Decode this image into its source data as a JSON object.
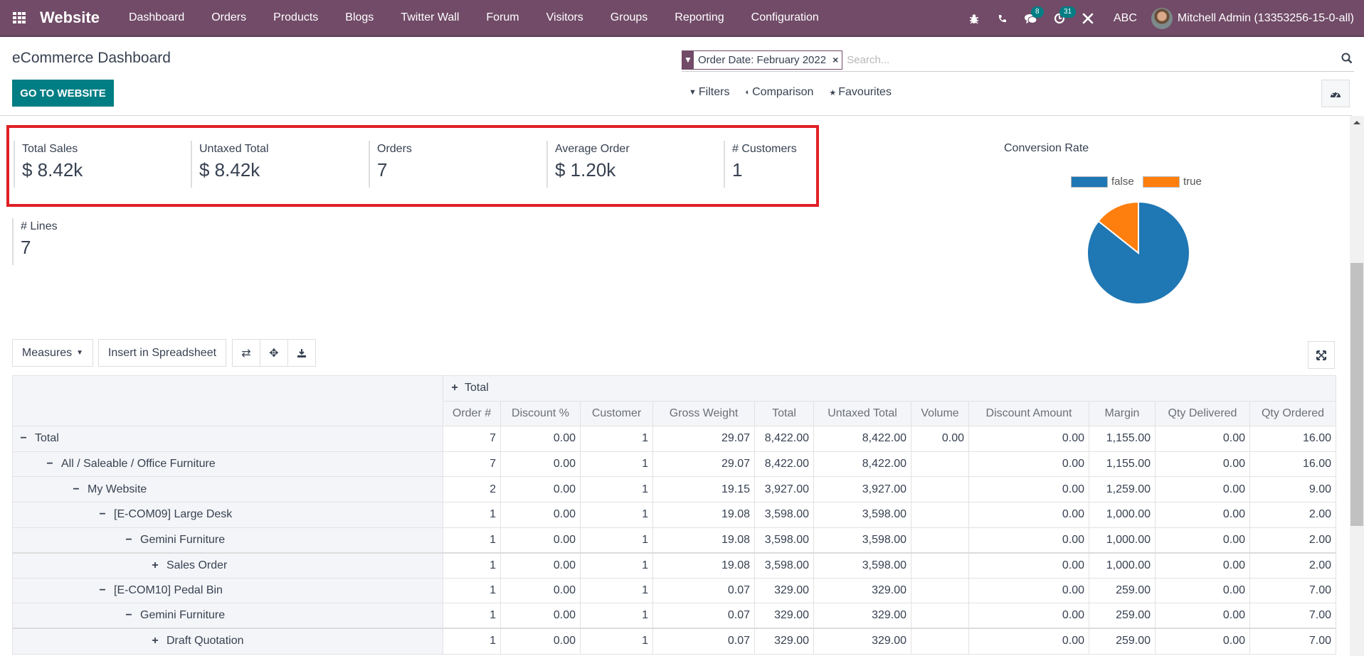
{
  "navbar": {
    "app_name": "Website",
    "menu": [
      "Dashboard",
      "Orders",
      "Products",
      "Blogs",
      "Twitter Wall",
      "Forum",
      "Visitors",
      "Groups",
      "Reporting",
      "Configuration"
    ],
    "icons": [
      "bug-icon",
      "phone-icon",
      "chat-icon",
      "activity-clock-icon",
      "tools-icon"
    ],
    "messages_badge": "8",
    "activities_badge": "31",
    "company": "ABC",
    "user": "Mitchell Admin (13353256-15-0-all)"
  },
  "control_panel": {
    "title": "eCommerce Dashboard",
    "go_to_website": "GO TO WEBSITE",
    "facet_value": "Order Date: February 2022",
    "search_placeholder": "Search...",
    "filters": "Filters",
    "comparison": "Comparison",
    "favourites": "Favourites"
  },
  "kpis": [
    {
      "label": "Total Sales",
      "value": "$ 8.42k"
    },
    {
      "label": "Untaxed Total",
      "value": "$ 8.42k"
    },
    {
      "label": "Orders",
      "value": "7"
    },
    {
      "label": "Average Order",
      "value": "$ 1.20k"
    },
    {
      "label": "# Customers",
      "value": "1"
    },
    {
      "label": "# Lines",
      "value": "7"
    }
  ],
  "chart_data": {
    "type": "pie",
    "title": "Conversion Rate",
    "categories": [
      "false",
      "true"
    ],
    "values": [
      6,
      1
    ],
    "colors": [
      "#1f77b4",
      "#ff7f0e"
    ],
    "legend": "top"
  },
  "pivot_toolbar": {
    "measures": "Measures",
    "insert": "Insert in Spreadsheet"
  },
  "pivot": {
    "col_group": "Total",
    "columns": [
      "Order #",
      "Discount %",
      "Customer",
      "Gross Weight",
      "Total",
      "Untaxed Total",
      "Volume",
      "Discount Amount",
      "Margin",
      "Qty Delivered",
      "Qty Ordered"
    ],
    "rows": [
      {
        "label": "Total",
        "level": 0,
        "toggle": "minus",
        "values": [
          "7",
          "0.00",
          "1",
          "29.07",
          "8,422.00",
          "8,422.00",
          "0.00",
          "0.00",
          "1,155.00",
          "0.00",
          "16.00"
        ]
      },
      {
        "label": "All / Saleable / Office Furniture",
        "level": 1,
        "toggle": "minus",
        "values": [
          "7",
          "0.00",
          "1",
          "29.07",
          "8,422.00",
          "8,422.00",
          "",
          "0.00",
          "1,155.00",
          "0.00",
          "16.00"
        ]
      },
      {
        "label": "My Website",
        "level": 2,
        "toggle": "minus",
        "values": [
          "2",
          "0.00",
          "1",
          "19.15",
          "3,927.00",
          "3,927.00",
          "",
          "0.00",
          "1,259.00",
          "0.00",
          "9.00"
        ]
      },
      {
        "label": "[E-COM09] Large Desk",
        "level": 3,
        "toggle": "minus",
        "values": [
          "1",
          "0.00",
          "1",
          "19.08",
          "3,598.00",
          "3,598.00",
          "",
          "0.00",
          "1,000.00",
          "0.00",
          "2.00"
        ]
      },
      {
        "label": "Gemini Furniture",
        "level": 4,
        "toggle": "minus",
        "values": [
          "1",
          "0.00",
          "1",
          "19.08",
          "3,598.00",
          "3,598.00",
          "",
          "0.00",
          "1,000.00",
          "0.00",
          "2.00"
        ]
      },
      {
        "label": "Sales Order",
        "level": 5,
        "toggle": "plus",
        "values": [
          "1",
          "0.00",
          "1",
          "19.08",
          "3,598.00",
          "3,598.00",
          "",
          "0.00",
          "1,000.00",
          "0.00",
          "2.00"
        ]
      },
      {
        "label": "[E-COM10] Pedal Bin",
        "level": 3,
        "toggle": "minus",
        "values": [
          "1",
          "0.00",
          "1",
          "0.07",
          "329.00",
          "329.00",
          "",
          "0.00",
          "259.00",
          "0.00",
          "7.00"
        ]
      },
      {
        "label": "Gemini Furniture",
        "level": 4,
        "toggle": "minus",
        "values": [
          "1",
          "0.00",
          "1",
          "0.07",
          "329.00",
          "329.00",
          "",
          "0.00",
          "259.00",
          "0.00",
          "7.00"
        ]
      },
      {
        "label": "Draft Quotation",
        "level": 5,
        "toggle": "plus",
        "values": [
          "1",
          "0.00",
          "1",
          "0.07",
          "329.00",
          "329.00",
          "",
          "0.00",
          "259.00",
          "0.00",
          "7.00"
        ]
      }
    ]
  }
}
